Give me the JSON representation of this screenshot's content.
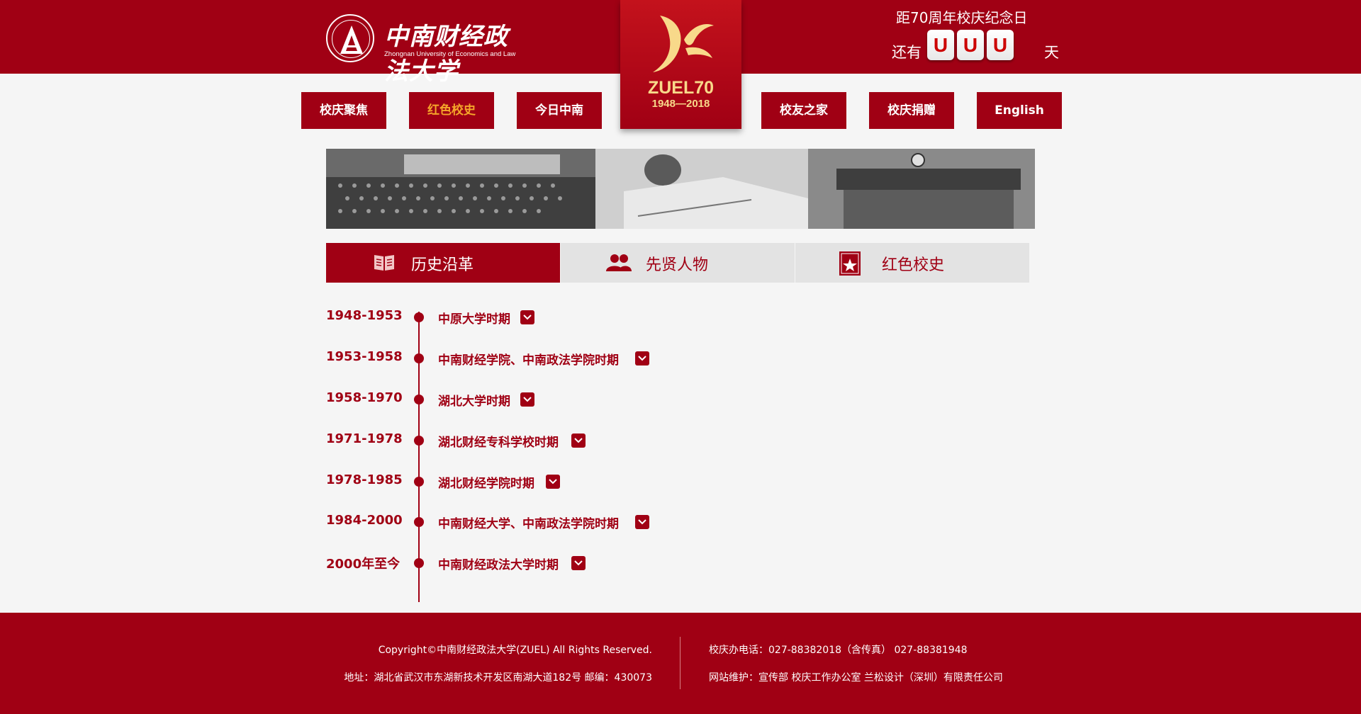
{
  "header": {
    "logo_cn": "中南财经政法大学",
    "logo_en": "Zhongnan University of Economics and Law",
    "badge_title": "ZUEL70",
    "badge_years": "1948—2018",
    "countdown": {
      "title": "距70周年校庆纪念日",
      "prefix": "还有",
      "suffix": "天",
      "digits": [
        "U",
        "U",
        "U"
      ]
    }
  },
  "nav": [
    {
      "label": "校庆聚焦",
      "active": false
    },
    {
      "label": "红色校史",
      "active": true
    },
    {
      "label": "今日中南",
      "active": false
    },
    {
      "label": "校友之家",
      "active": false
    },
    {
      "label": "校庆捐赠",
      "active": false
    },
    {
      "label": "English",
      "active": false
    }
  ],
  "tabs": [
    {
      "label": "历史沿革",
      "icon": "book-icon",
      "active": true
    },
    {
      "label": "先贤人物",
      "icon": "people-icon",
      "active": false
    },
    {
      "label": "红色校史",
      "icon": "red-book-star-icon",
      "active": false
    }
  ],
  "timeline": [
    {
      "years": "1948-1953",
      "name": "中原大学时期"
    },
    {
      "years": "1953-1958",
      "name": "中南财经学院、中南政法学院时期"
    },
    {
      "years": "1958-1970",
      "name": "湖北大学时期"
    },
    {
      "years": "1971-1978",
      "name": "湖北财经专科学校时期"
    },
    {
      "years": "1978-1985",
      "name": "湖北财经学院时期"
    },
    {
      "years": "1984-2000",
      "name": "中南财经大学、中南政法学院时期"
    },
    {
      "years": "2000年至今",
      "name": "中南财经政法大学时期"
    }
  ],
  "footer": {
    "copyright": "Copyright©中南财经政法大学(ZUEL) All Rights Reserved.",
    "address": "地址：湖北省武汉市东湖新技术开发区南湖大道182号 邮编：430073",
    "phone": "校庆办电话：027-88382018（含传真） 027-88381948",
    "maintain": "网站维护：宣传部 校庆工作办公室 兰松设计（深圳）有限责任公司"
  },
  "colors": {
    "primary": "#a00014",
    "nav_active_text": "#f5a62a",
    "badge_gold": "#f8d98a"
  }
}
